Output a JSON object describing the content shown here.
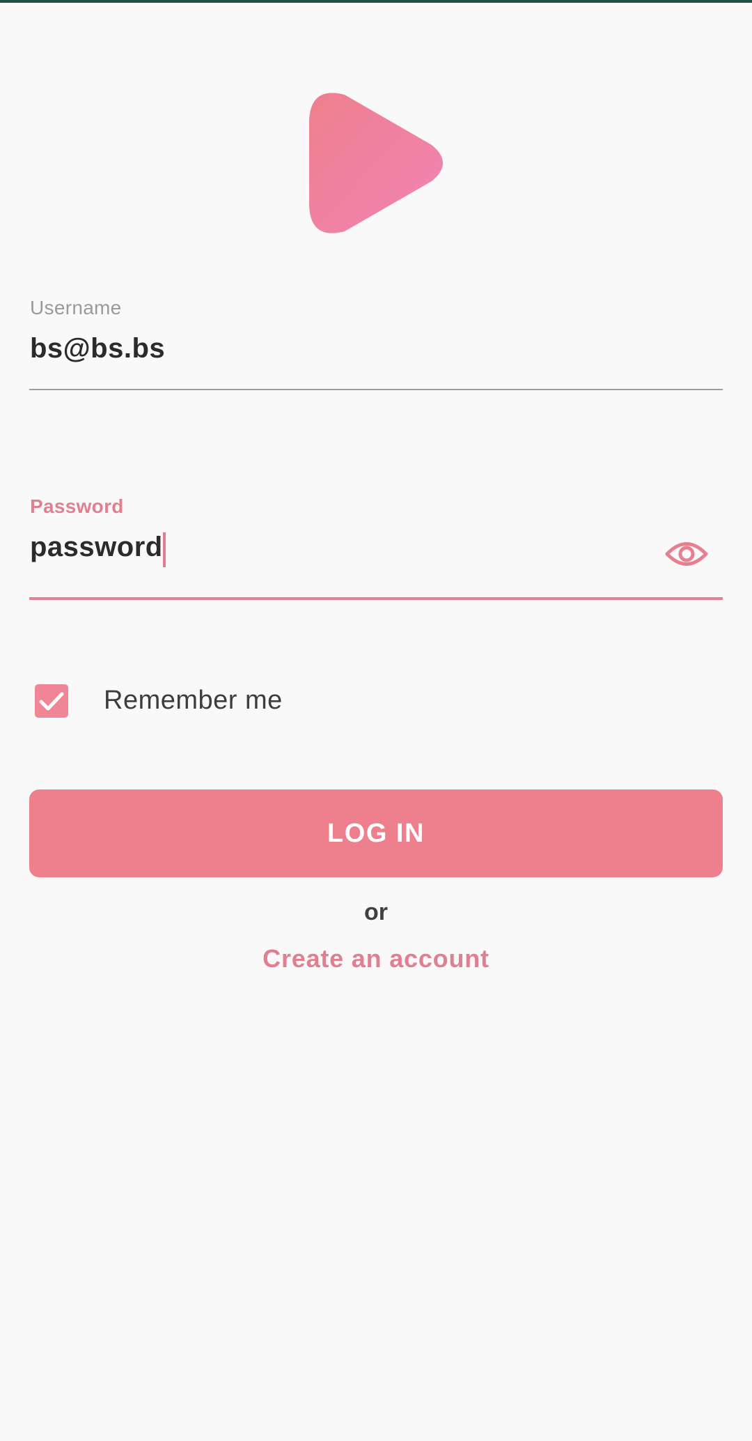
{
  "colors": {
    "accent": "#ee7f8d",
    "accent_text": "#e07f8f",
    "logo_gradient_start": "#ee7f8c",
    "logo_gradient_end": "#f184b6",
    "background": "#faf9fa",
    "status_strip": "#1f4f45"
  },
  "logo": {
    "icon": "play-icon"
  },
  "form": {
    "username": {
      "label": "Username",
      "value": "bs@bs.bs"
    },
    "password": {
      "label": "Password",
      "value": "password",
      "toggle_icon": "eye-icon",
      "focused": true
    },
    "remember_me": {
      "label": "Remember me",
      "checked": true,
      "icon": "check-icon"
    },
    "login_button_label": "LOG IN",
    "separator_text": "or",
    "create_account_label": "Create an account"
  }
}
